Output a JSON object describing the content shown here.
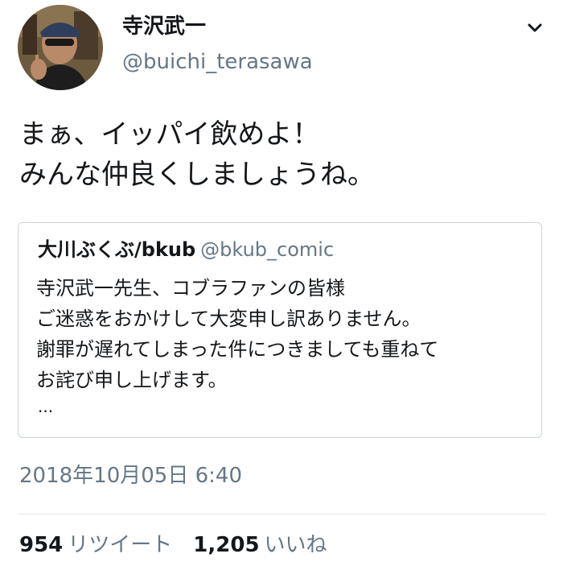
{
  "tweet": {
    "author": {
      "display_name": "寺沢武一",
      "handle": "@buichi_terasawa"
    },
    "text_lines": [
      "まぁ、イッパイ飲めよ！",
      "みんな仲良くしましょうね。"
    ],
    "quoted": {
      "display_name": "大川ぶくぶ/bkub",
      "handle": "@bkub_comic",
      "text_lines": [
        "寺沢武一先生、コブラファンの皆様",
        "ご迷惑をおかけして大変申し訳ありません。",
        "謝罪が遅れてしまった件につきましても重ねて",
        "お詫び申し上げます。"
      ],
      "ellipsis": "..."
    },
    "timestamp": "2018年10月05日 6:40",
    "stats": {
      "retweets_count": "954",
      "retweets_label": "リツイート",
      "likes_count": "1,205",
      "likes_label": "いいね"
    }
  },
  "icons": {
    "menu": "chevron-down-icon",
    "avatar": "avatar"
  },
  "colors": {
    "text_primary": "#14171a",
    "text_secondary": "#657786",
    "border": "#ccd6dd"
  }
}
